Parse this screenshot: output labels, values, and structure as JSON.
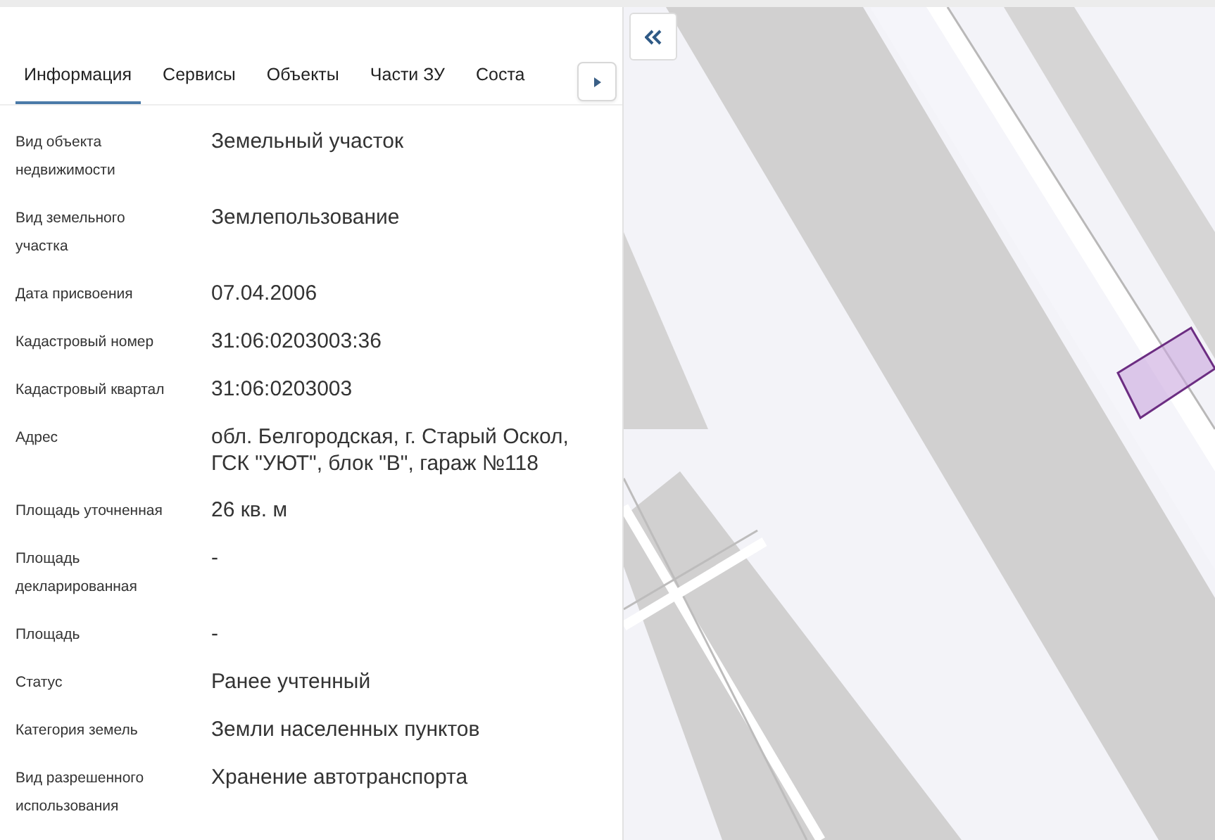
{
  "tabs": [
    {
      "label": "Информация",
      "selected": true
    },
    {
      "label": "Сервисы",
      "selected": false
    },
    {
      "label": "Объекты",
      "selected": false
    },
    {
      "label": "Части ЗУ",
      "selected": false
    },
    {
      "label": "Соста",
      "selected": false
    }
  ],
  "fields": [
    {
      "label": "Вид объекта недвижимости",
      "value": "Земельный участок"
    },
    {
      "label": "Вид земельного участка",
      "value": "Землепользование"
    },
    {
      "label": "Дата присвоения",
      "value": "07.04.2006"
    },
    {
      "label": "Кадастровый номер",
      "value": "31:06:0203003:36"
    },
    {
      "label": "Кадастровый квартал",
      "value": "31:06:0203003"
    },
    {
      "label": "Адрес",
      "value": "обл. Белгородская, г. Старый Оскол, ГСК \"УЮТ\", блок \"В\", гараж №118"
    },
    {
      "label": "Площадь уточненная",
      "value": "26 кв. м"
    },
    {
      "label": "Площадь декларированная",
      "value": "-"
    },
    {
      "label": "Площадь",
      "value": "-"
    },
    {
      "label": "Статус",
      "value": "Ранее учтенный"
    },
    {
      "label": "Категория земель",
      "value": "Земли населенных пунктов"
    },
    {
      "label": "Вид разрешенного использования",
      "value": "Хранение автотранспорта"
    }
  ]
}
